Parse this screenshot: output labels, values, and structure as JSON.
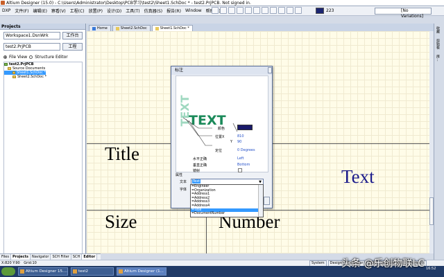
{
  "window": {
    "title": "Altium Designer (15.0) - C:\\Users\\Administrator\\Desktop\\PCB学习\\test2\\Sheet1.SchDoc * - test2.PrjPCB. Not signed in."
  },
  "menu": [
    "DXP",
    "文件(F)",
    "编辑(E)",
    "察看(V)",
    "工程(C)",
    "放置(P)",
    "设计(D)",
    "工具(T)",
    "仿真器(S)",
    "报告(R)",
    "Window",
    "帮助(H)"
  ],
  "toolbar": {
    "zoom": "223",
    "variations": "[No Variations]"
  },
  "projects_panel": {
    "header": "Projects",
    "workspace": "Workspace1.DsnWrk",
    "workspace_btn": "工作台",
    "project": "test2.PrjPCB",
    "project_btn": "工程",
    "file_view": "File View",
    "structure_editor": "Structure Editor",
    "tree": [
      "test2.PrjPCB",
      "Source Documents",
      "Sheet1.SchDoc *",
      "Sheet2.SchDoc *"
    ]
  },
  "doc_tabs": [
    "Home",
    "Sheet2.SchDoc",
    "Sheet1.SchDoc *"
  ],
  "canvas": {
    "title": "Title",
    "size": "Size",
    "number": "Number",
    "placed_text": "Text",
    "placed_text_color": "#1a1a8a"
  },
  "dialog": {
    "title": "标注",
    "preview_text": "TEXT",
    "color_label": "颜色",
    "color_value": "#1a1a6a",
    "location_label": "位置X",
    "x_value": "810",
    "y_label": "Y",
    "y_value": "90",
    "orientation_label": "定位",
    "orientation_value": "0 Degrees",
    "h_just_label": "水平正确",
    "h_just_value": "Left",
    "v_just_label": "垂直正确",
    "v_just_value": "Bottom",
    "mirror_label": "镜射",
    "properties_label": "属性",
    "text_label": "文本",
    "text_value": "Text",
    "font_label": "字体",
    "options": [
      "=Engineer",
      "=Organization",
      "=Address1",
      "=Address2",
      "=Address3",
      "=Address4",
      "=Title",
      "=DocumentNumber"
    ],
    "selected_option": "=Title"
  },
  "bottom_tabs": [
    "Files",
    "Projects",
    "Navigator",
    "SCH Filter",
    "SCH",
    "Editor"
  ],
  "status": {
    "coords": "X:820 Y:90",
    "grid": "Grid:10",
    "right": [
      "System",
      "Design",
      "Compiler",
      "SCH",
      "Instruments",
      "Shortcuts"
    ]
  },
  "right_strip": [
    "收藏",
    "剪贴板",
    "库..."
  ],
  "taskbar": {
    "tasks": [
      "Altium Designer 15....",
      "test2",
      "Altium Designer (1..."
    ],
    "clock": "16:52"
  },
  "watermark": "头条 @乐创物联LC"
}
